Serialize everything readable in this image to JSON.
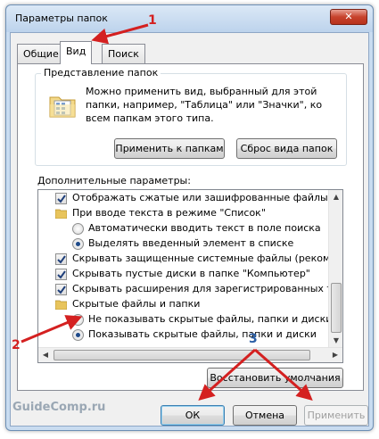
{
  "window": {
    "title": "Параметры папок",
    "close_symbol": "✕"
  },
  "tabs": [
    "Общие",
    "Вид",
    "Поиск"
  ],
  "folder_view": {
    "title": "Представление папок",
    "description": "Можно применить вид, выбранный для этой папки, например, \"Таблица\" или \"Значки\", ко всем папкам этого типа.",
    "apply_button": "Применить к папкам",
    "reset_button": "Сброс вида папок"
  },
  "advanced": {
    "label": "Дополнительные параметры:",
    "items": [
      {
        "type": "checkbox",
        "checked": true,
        "text": "Отображать сжатые или зашифрованные файлы NTFS"
      },
      {
        "type": "folder",
        "text": "При вводе текста в режиме \"Список\""
      },
      {
        "type": "radio",
        "checked": false,
        "text": "Автоматически вводить текст в поле поиска"
      },
      {
        "type": "radio",
        "checked": true,
        "text": "Выделять введенный элемент в списке"
      },
      {
        "type": "checkbox",
        "checked": true,
        "text": "Скрывать защищенные системные файлы (рекомендуется)"
      },
      {
        "type": "checkbox",
        "checked": true,
        "text": "Скрывать пустые диски в папке \"Компьютер\""
      },
      {
        "type": "checkbox",
        "checked": true,
        "text": "Скрывать расширения для зарегистрированных типов файлов"
      },
      {
        "type": "folder",
        "text": "Скрытые файлы и папки"
      },
      {
        "type": "radio",
        "checked": false,
        "text": "Не показывать скрытые файлы, папки и диски"
      },
      {
        "type": "radio",
        "checked": true,
        "text": "Показывать скрытые файлы, папки и диски"
      }
    ],
    "restore_button": "Восстановить умолчания"
  },
  "footer": {
    "ok": "ОК",
    "cancel": "Отмена",
    "apply": "Применить"
  },
  "watermark": "GuideComp.ru",
  "annotations": {
    "n1": "1",
    "n2": "2",
    "n3": "3"
  },
  "colors": {
    "annotation_red": "#d42020",
    "annotation_blue": "#2b5fa6",
    "title_bar": "#c9dcf0"
  }
}
